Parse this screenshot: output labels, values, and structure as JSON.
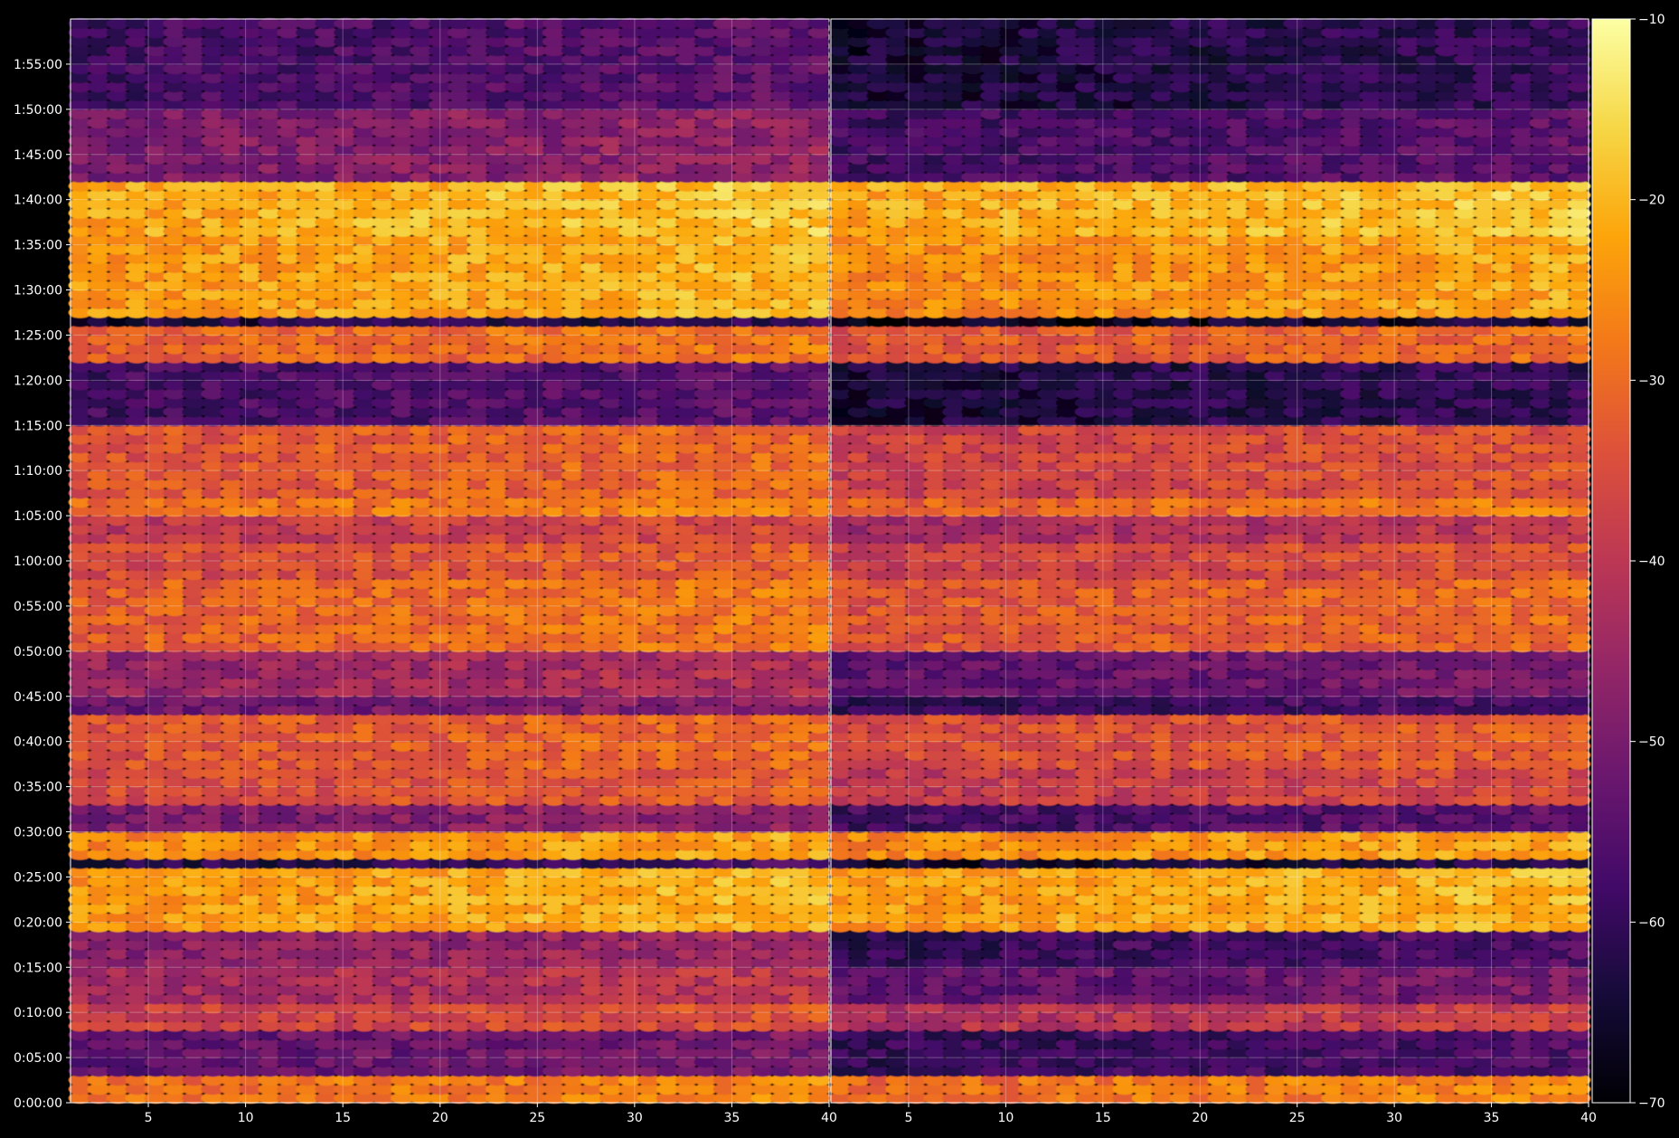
{
  "chart_data": [
    {
      "type": "heatmap",
      "title": "",
      "xlabel": "",
      "ylabel": "",
      "xlim": [
        1,
        40
      ],
      "x_ticks": [
        5,
        10,
        15,
        20,
        25,
        30,
        35,
        40
      ],
      "x_tick_labels": [
        "5",
        "10",
        "15",
        "20",
        "25",
        "30",
        "35",
        "40"
      ],
      "ylim_seconds": [
        0,
        7200
      ],
      "y_ticks": [
        "0:00:00",
        "0:05:00",
        "0:10:00",
        "0:15:00",
        "0:20:00",
        "0:25:00",
        "0:30:00",
        "0:35:00",
        "0:40:00",
        "0:45:00",
        "0:50:00",
        "0:55:00",
        "1:00:00",
        "1:05:00",
        "1:10:00",
        "1:15:00",
        "1:20:00",
        "1:25:00",
        "1:30:00",
        "1:35:00",
        "1:40:00",
        "1:45:00",
        "1:50:00",
        "1:55:00"
      ],
      "grid": true,
      "colormap": "inferno",
      "description_of_values": "color intensity per bin, rows by time, columns by index",
      "bands": [
        {
          "start": "0:00:00",
          "end": "0:03:00",
          "value": -28
        },
        {
          "start": "0:03:00",
          "end": "0:08:00",
          "value": -52
        },
        {
          "start": "0:08:00",
          "end": "0:11:00",
          "value": -36
        },
        {
          "start": "0:11:00",
          "end": "0:15:00",
          "value": -42
        },
        {
          "start": "0:15:00",
          "end": "0:19:00",
          "value": -46
        },
        {
          "start": "0:19:00",
          "end": "0:26:00",
          "value": -22
        },
        {
          "start": "0:26:00",
          "end": "0:27:00",
          "value": -60
        },
        {
          "start": "0:27:00",
          "end": "0:30:00",
          "value": -24
        },
        {
          "start": "0:30:00",
          "end": "0:33:00",
          "value": -48
        },
        {
          "start": "0:33:00",
          "end": "0:37:00",
          "value": -34
        },
        {
          "start": "0:37:00",
          "end": "0:43:00",
          "value": -32
        },
        {
          "start": "0:43:00",
          "end": "0:45:00",
          "value": -50
        },
        {
          "start": "0:45:00",
          "end": "0:50:00",
          "value": -44
        },
        {
          "start": "0:50:00",
          "end": "0:58:00",
          "value": -30
        },
        {
          "start": "0:58:00",
          "end": "1:02:00",
          "value": -34
        },
        {
          "start": "1:02:00",
          "end": "1:05:00",
          "value": -38
        },
        {
          "start": "1:05:00",
          "end": "1:07:00",
          "value": -28
        },
        {
          "start": "1:07:00",
          "end": "1:15:00",
          "value": -32
        },
        {
          "start": "1:15:00",
          "end": "1:22:00",
          "value": -56
        },
        {
          "start": "1:22:00",
          "end": "1:26:00",
          "value": -30
        },
        {
          "start": "1:26:00",
          "end": "1:27:00",
          "value": -62
        },
        {
          "start": "1:27:00",
          "end": "1:36:00",
          "value": -22
        },
        {
          "start": "1:36:00",
          "end": "1:42:00",
          "value": -20
        },
        {
          "start": "1:42:00",
          "end": "1:50:00",
          "value": -48
        },
        {
          "start": "1:50:00",
          "end": "2:00:00",
          "value": -56
        }
      ]
    },
    {
      "type": "heatmap",
      "title": "",
      "xlabel": "",
      "ylabel": "",
      "xlim": [
        1,
        40
      ],
      "x_ticks": [
        5,
        10,
        15,
        20,
        25,
        30,
        35,
        40
      ],
      "x_tick_labels": [
        "5",
        "10",
        "15",
        "20",
        "25",
        "30",
        "35",
        "40"
      ],
      "ylim_seconds": [
        0,
        7200
      ],
      "grid": true,
      "colormap": "inferno",
      "bands": [
        {
          "start": "0:00:00",
          "end": "0:03:00",
          "value": -28
        },
        {
          "start": "0:03:00",
          "end": "0:08:00",
          "value": -58
        },
        {
          "start": "0:08:00",
          "end": "0:11:00",
          "value": -40
        },
        {
          "start": "0:11:00",
          "end": "0:15:00",
          "value": -52
        },
        {
          "start": "0:15:00",
          "end": "0:19:00",
          "value": -58
        },
        {
          "start": "0:19:00",
          "end": "0:26:00",
          "value": -22
        },
        {
          "start": "0:26:00",
          "end": "0:27:00",
          "value": -64
        },
        {
          "start": "0:27:00",
          "end": "0:30:00",
          "value": -24
        },
        {
          "start": "0:30:00",
          "end": "0:33:00",
          "value": -56
        },
        {
          "start": "0:33:00",
          "end": "0:37:00",
          "value": -38
        },
        {
          "start": "0:37:00",
          "end": "0:43:00",
          "value": -34
        },
        {
          "start": "0:43:00",
          "end": "0:45:00",
          "value": -58
        },
        {
          "start": "0:45:00",
          "end": "0:50:00",
          "value": -52
        },
        {
          "start": "0:50:00",
          "end": "0:58:00",
          "value": -32
        },
        {
          "start": "0:58:00",
          "end": "1:02:00",
          "value": -36
        },
        {
          "start": "1:02:00",
          "end": "1:05:00",
          "value": -42
        },
        {
          "start": "1:05:00",
          "end": "1:07:00",
          "value": -30
        },
        {
          "start": "1:07:00",
          "end": "1:15:00",
          "value": -36
        },
        {
          "start": "1:15:00",
          "end": "1:22:00",
          "value": -62
        },
        {
          "start": "1:22:00",
          "end": "1:26:00",
          "value": -32
        },
        {
          "start": "1:26:00",
          "end": "1:27:00",
          "value": -66
        },
        {
          "start": "1:27:00",
          "end": "1:36:00",
          "value": -24
        },
        {
          "start": "1:36:00",
          "end": "1:42:00",
          "value": -20
        },
        {
          "start": "1:42:00",
          "end": "1:50:00",
          "value": -56
        },
        {
          "start": "1:50:00",
          "end": "2:00:00",
          "value": -62
        }
      ]
    },
    {
      "type": "colorbar",
      "colormap": "inferno",
      "range": [
        -70,
        -10
      ],
      "ticks": [
        -10,
        -20,
        -30,
        -40,
        -50,
        -60,
        -70
      ],
      "tick_labels": [
        "−10",
        "−20",
        "−30",
        "−40",
        "−50",
        "−60",
        "−70"
      ]
    }
  ]
}
